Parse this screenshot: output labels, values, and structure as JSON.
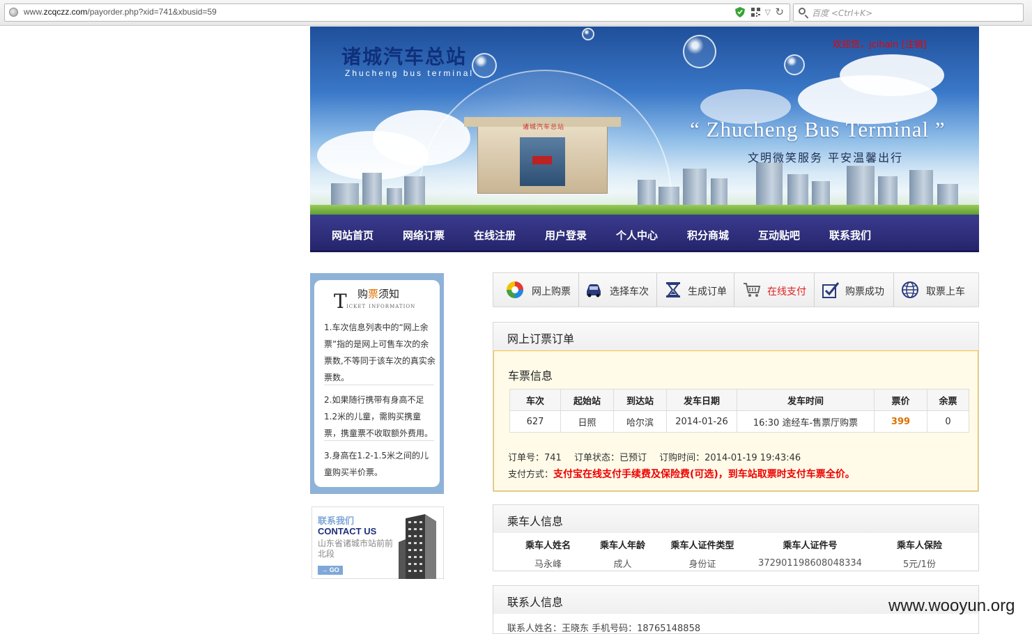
{
  "browser": {
    "url_prefix": "www.",
    "url_domain": "zcqczz.com",
    "url_path": "/payorder.php?xid=741&xbusid=59",
    "search_placeholder": "百度 <Ctrl+K>"
  },
  "header": {
    "logo_cn": "诸城汽车总站",
    "logo_en": "Zhucheng bus terminal",
    "welcome": "欢迎您，jcihain  [注销]",
    "station_sign": "诸城汽车总站",
    "banner_en": "“ Zhucheng Bus Terminal ”",
    "slogan": "文明微笑服务  平安温馨出行"
  },
  "nav": [
    {
      "label": "网站首页"
    },
    {
      "label": "网络订票"
    },
    {
      "label": "在线注册"
    },
    {
      "label": "用户登录"
    },
    {
      "label": "个人中心"
    },
    {
      "label": "积分商城"
    },
    {
      "label": "互动贴吧"
    },
    {
      "label": "联系我们"
    }
  ],
  "notice": {
    "title_pre": "购",
    "title_hl": "票",
    "title_post": "须知",
    "title_T": "T",
    "title_en": "icket information",
    "items": [
      "1.车次信息列表中的“网上余票”指的是网上可售车次的余票数,不等同于该车次的真实余票数。",
      "2.如果随行携带有身高不足1.2米的儿童，需购买携童票，携童票不收取额外费用。",
      "3.身高在1.2-1.5米之间的儿童购买半价票。"
    ]
  },
  "contact_box": {
    "title_cn": "联系我们",
    "title_en": "CONTACT US",
    "address": "山东省诸城市站前前北段",
    "go": "→ GO"
  },
  "steps": [
    {
      "label": "网上购票",
      "icon": "color-wheel-icon"
    },
    {
      "label": "选择车次",
      "icon": "car-icon"
    },
    {
      "label": "生成订单",
      "icon": "hourglass-icon"
    },
    {
      "label": "在线支付",
      "icon": "cart-icon",
      "active": true
    },
    {
      "label": "购票成功",
      "icon": "checkmark-icon"
    },
    {
      "label": "取票上车",
      "icon": "globe-icon"
    }
  ],
  "order": {
    "panel_title": "网上订票订单",
    "ticket_title": "车票信息",
    "columns": [
      "车次",
      "起始站",
      "到达站",
      "发车日期",
      "发车时间",
      "票价",
      "余票"
    ],
    "row": [
      "627",
      "日照",
      "哈尔滨",
      "2014-01-26",
      "16:30 途经车-售票厅购票",
      "399",
      "0"
    ],
    "order_no": "订单号：741",
    "status": "订单状态：已预订",
    "order_time": "订购时间：2014-01-19 19:43:46",
    "pay_label": "支付方式：",
    "pay_text": "支付宝在线支付手续费及保险费(可选)，到车站取票时支付车票全价。"
  },
  "passenger": {
    "panel_title": "乘车人信息",
    "columns": [
      "乘车人姓名",
      "乘车人年龄",
      "乘车人证件类型",
      "乘车人证件号",
      "乘车人保险"
    ],
    "row": [
      "马永峰",
      "成人",
      "身份证",
      "372901198608048334",
      "5元/1份"
    ]
  },
  "contact_info": {
    "panel_title": "联系人信息",
    "line": "联系人姓名：王晓东    手机号码：18765148858"
  },
  "watermark": "www.wooyun.org",
  "colors": {
    "nav_bg": "#2b2b78",
    "active_step": "#e21e1e",
    "price": "#e07000",
    "pay_highlight": "#e00000",
    "order_bg": "#fffbe8",
    "order_border": "#f0c040"
  }
}
